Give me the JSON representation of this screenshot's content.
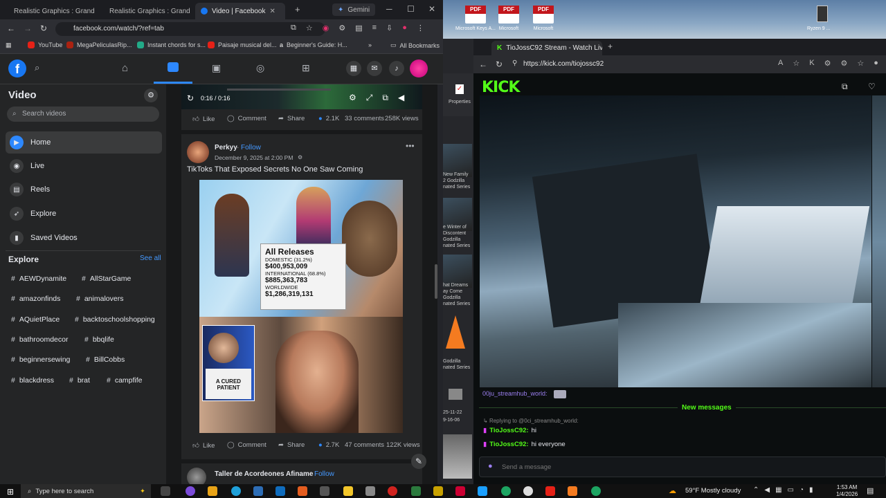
{
  "left_browser": {
    "tabs": [
      "Realistic Graphics : Grand",
      "Realistic Graphics : Grand",
      "Video | Facebook",
      "Gemini"
    ],
    "url": "facebook.com/watch/?ref=tab",
    "bookmarks": [
      "YouTube",
      "MegaPeliculasRip...",
      "Instant chords for s...",
      "Paisaje musical del...",
      "Beginner's Guide: H...",
      "All Bookmarks"
    ]
  },
  "facebook": {
    "sidebar": {
      "title": "Video",
      "search_placeholder": "Search videos",
      "items": [
        "Home",
        "Live",
        "Reels",
        "Explore",
        "Saved Videos"
      ],
      "explore_title": "Explore",
      "see_all": "See all",
      "tags": [
        [
          "AEWDynamite",
          "AllStarGame"
        ],
        [
          "amazonfinds",
          "animalovers"
        ],
        [
          "AQuietPlace",
          "backtoschoolshopping"
        ],
        [
          "bathroomdecor",
          "bbqlife"
        ],
        [
          "beginnersewing",
          "BillCobbs"
        ],
        [
          "blackdress",
          "brat",
          "campfife"
        ]
      ]
    },
    "video_time": "0:16 / 0:16",
    "post1_actions": {
      "like": "Like",
      "comment": "Comment",
      "share": "Share",
      "reactions": "2.1K",
      "comments": "33 comments",
      "views": "258K views"
    },
    "post2": {
      "author": "Perkyy",
      "follow": "Follow",
      "date": "December 9, 2025 at 2:00 PM",
      "title": "TikToks That Exposed Secrets No One Saw Coming",
      "overlay_title": "All Releases",
      "overlay_lines": [
        "DOMESTIC (31.2%)",
        "$400,953,009",
        "INTERNATIONAL (68.8%)",
        "$885,363,783",
        "WORLDWIDE",
        "$1,286,319,131"
      ],
      "shirt_text": "A CURED PATIENT"
    },
    "post2_actions": {
      "like": "Like",
      "comment": "Comment",
      "share": "Share",
      "reactions": "2.7K",
      "comments": "47 comments",
      "views": "122K views"
    },
    "post3_author": "Taller de Acordeones Afiname",
    "post3_follow": "Follow"
  },
  "desktop": {
    "pdf_icons": [
      "Microsoft",
      "Microsoft",
      "Microsoft"
    ],
    "pdf_sub": [
      "Keys A...",
      "",
      ""
    ],
    "side_labels": [
      "Ryzen 9 ..."
    ],
    "explorer_label": "Properties",
    "thumb_labels": [
      "New Family 2 Godzilla nated Series",
      "e Winter of Discontent Godzilla nated Series",
      "hat Dreams ay Come Godzilla nated Series",
      "Godzilla nated Series"
    ],
    "date_fragment": [
      "25-11-22",
      "9-16-06"
    ]
  },
  "kick": {
    "tab_title": "TioJossC92 Stream - Watch Live o",
    "url": "https://kick.com/tiojossc92",
    "logo": "KICK",
    "chat": {
      "first_user": "00ju_streamhub_world:",
      "new_messages": "New messages",
      "reply_hint": "Replying to @0ci_streamhub_world:",
      "messages": [
        {
          "user": "TioJossC92:",
          "text": "hi"
        },
        {
          "user": "TioJossC92:",
          "text": "hi everyone"
        }
      ],
      "input_placeholder": "Send a message"
    }
  },
  "taskbar": {
    "search": "Type here to search",
    "weather": "59°F  Mostly cloudy",
    "time": "1:53 AM",
    "date": "1/4/2026"
  }
}
